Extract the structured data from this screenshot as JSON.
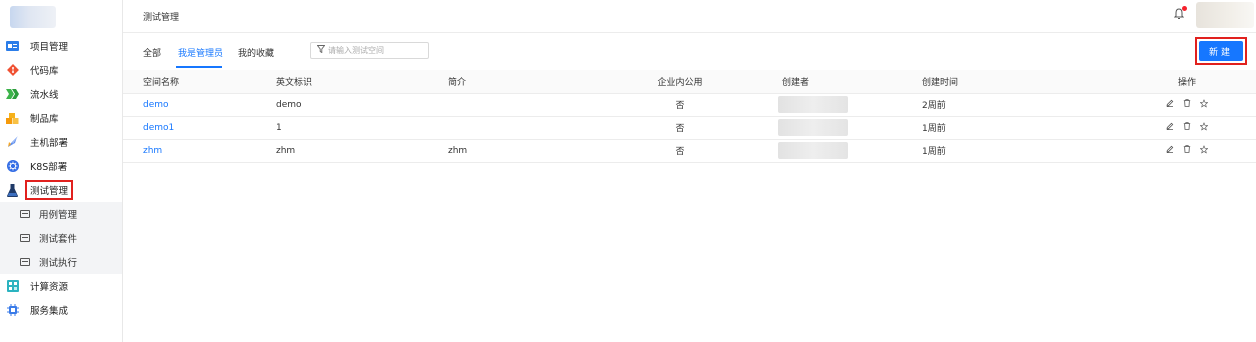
{
  "header": {
    "title": "测试管理"
  },
  "sidebar": {
    "items": [
      {
        "label": "项目管理",
        "icon": "project-icon"
      },
      {
        "label": "代码库",
        "icon": "git-icon"
      },
      {
        "label": "流水线",
        "icon": "pipeline-icon"
      },
      {
        "label": "制品库",
        "icon": "artifact-icon"
      },
      {
        "label": "主机部署",
        "icon": "host-deploy-icon"
      },
      {
        "label": "K8S部署",
        "icon": "k8s-icon"
      },
      {
        "label": "测试管理",
        "icon": "flask-icon",
        "active": true
      },
      {
        "label": "计算资源",
        "icon": "compute-icon"
      },
      {
        "label": "服务集成",
        "icon": "integration-icon"
      }
    ],
    "sub_items": [
      {
        "label": "用例管理"
      },
      {
        "label": "测试套件"
      },
      {
        "label": "测试执行"
      }
    ]
  },
  "tabs": [
    {
      "label": "全部"
    },
    {
      "label": "我是管理员",
      "active": true
    },
    {
      "label": "我的收藏"
    }
  ],
  "search": {
    "placeholder": "请输入测试空间"
  },
  "new_button": {
    "label": "新建"
  },
  "table": {
    "headers": [
      "空间名称",
      "英文标识",
      "简介",
      "企业内公用",
      "创建者",
      "创建时间",
      "操作"
    ],
    "rows": [
      {
        "name": "demo",
        "en_id": "demo",
        "intro": "",
        "public": "否",
        "created": "2周前"
      },
      {
        "name": "demo1",
        "en_id": "1",
        "intro": "",
        "public": "否",
        "created": "1周前"
      },
      {
        "name": "zhm",
        "en_id": "zhm",
        "intro": "zhm",
        "public": "否",
        "created": "1周前"
      }
    ]
  },
  "colors": {
    "accent": "#1677ff",
    "highlight": "#e1211e"
  }
}
